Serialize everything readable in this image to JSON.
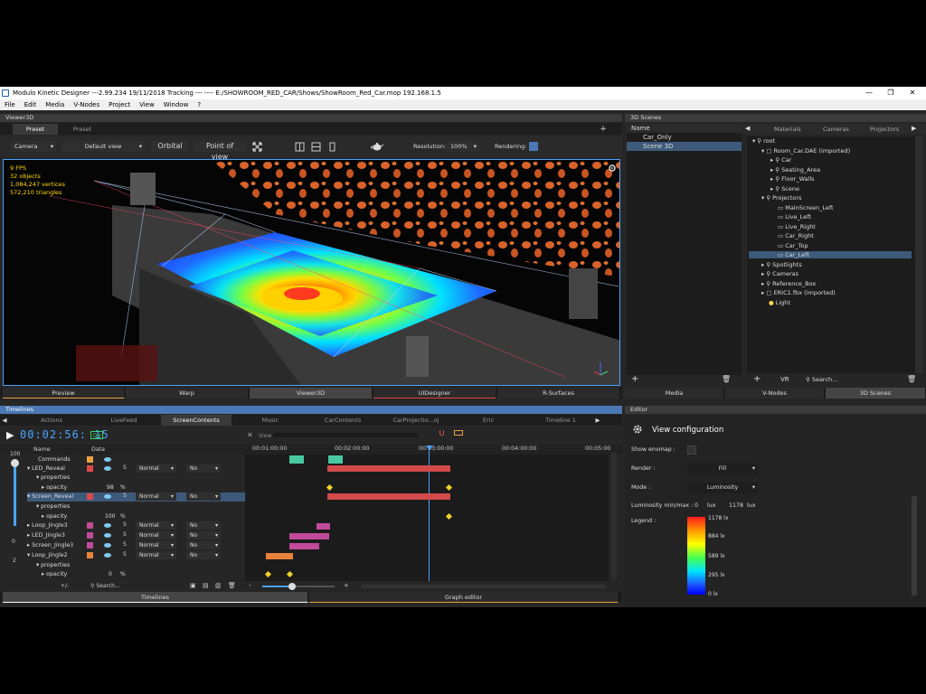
{
  "titlebar": {
    "title": "Modulo Kinetic Designer ---2.99.234 19/11/2018 Tracking ---  ----  E:/SHOWROOM_RED_CAR/Shows/ShowRoom_Red_Car.mop   192.168.1.5",
    "min": "—",
    "max": "❐",
    "close": "✕"
  },
  "menu": [
    "File",
    "Edit",
    "Media",
    "V-Nodes",
    "Project",
    "View",
    "Window",
    "?"
  ],
  "viewer": {
    "header": "Viewer3D",
    "tabs": [
      "Preset",
      "Preset"
    ],
    "plus": "+",
    "camera": "Camera",
    "view": "Default view",
    "orbital": "Orbital",
    "pov": "Point of view",
    "resolution_label": "Resolution:",
    "resolution": "100%",
    "rendering_label": "Rendering:",
    "stats": {
      "fps": "9 FPS",
      "objects": "32 objects",
      "vertices": "1,084,247 vertices",
      "triangles": "572,210 triangles"
    },
    "bottom_tabs": [
      "Preview",
      "Warp",
      "Viewer3D",
      "UIDesigner",
      "R-Surfaces"
    ],
    "colors": {
      "accent": "#4aa3ff",
      "highlight": "#4a78b4"
    }
  },
  "scenes": {
    "header": "3D Scenes",
    "list_header": "Name",
    "list": [
      "Car_Only",
      "Scene 3D"
    ],
    "tabs": [
      "Materials",
      "Cameras",
      "Projectors"
    ],
    "tree": [
      "root",
      "Room_Car.DAE (imported)",
      "Car",
      "Seating_Area",
      "Floor_Walls",
      "Scene",
      "Projectors",
      "MainScreen_Left",
      "Live_Left",
      "Live_Right",
      "Car_Right",
      "Car_Top",
      "Car_Left",
      "Spotlights",
      "Cameras",
      "Reference_Box",
      "ERIC1.fbx (imported)",
      "Light"
    ],
    "footer": {
      "vr": "VR",
      "search": "Search..."
    },
    "bottom_tabs": [
      "Media",
      "V-Nodes",
      "3D Scenes"
    ]
  },
  "timelines": {
    "header": "Timelines",
    "tabs": [
      "Actions",
      "LiveFeed",
      "ScreenContents",
      "Music",
      "CarContents",
      "CarProjectio...oj (imported)",
      "Eric",
      "Timeline 1"
    ],
    "timecode": "00:02:56: 15",
    "on": "ON",
    "view_label": "View",
    "col_name": "Name",
    "col_data": "Data",
    "ruler": [
      "00:01:00:00",
      "00:02:00:00",
      "00:03:00:00",
      "00:04:00:00",
      "00:05:00"
    ],
    "zoom_ticks": [
      "100",
      "0",
      "2"
    ],
    "rows": [
      {
        "name": "Commands"
      },
      {
        "name": "LED_Reveal",
        "s": "S",
        "blend": "Normal",
        "loop": "No"
      },
      {
        "name": "properties"
      },
      {
        "name": "opacity",
        "val": "98",
        "unit": "%"
      },
      {
        "name": "Screen_Reveal",
        "s": "S",
        "blend": "Normal",
        "loop": "No"
      },
      {
        "name": "properties"
      },
      {
        "name": "opacity",
        "val": "100",
        "unit": "%"
      },
      {
        "name": "Loop_Jingle3",
        "s": "S",
        "blend": "Normal",
        "loop": "No"
      },
      {
        "name": "LED_Jingle3",
        "s": "S",
        "blend": "Normal",
        "loop": "No"
      },
      {
        "name": "Screen_Jingle3",
        "s": "S",
        "blend": "Normal",
        "loop": "No"
      },
      {
        "name": "Loop_Jingle2",
        "s": "S",
        "blend": "Normal",
        "loop": "No"
      },
      {
        "name": "properties"
      },
      {
        "name": "opacity",
        "val": "0",
        "unit": "%"
      }
    ],
    "footer": {
      "plusminus": "+/-",
      "search": "Search...",
      "minus": "-",
      "plus": "+"
    },
    "bottom_tabs": [
      "Timelines",
      "Graph editor"
    ]
  },
  "editor": {
    "header": "Editor",
    "title": "View configuration",
    "envmap_label": "Show envmap :",
    "render_label": "Render :",
    "render": "Fill",
    "mode_label": "Mode :",
    "mode": "Luminosity",
    "lum_label": "Luminosity min/max :",
    "lum_min": "0",
    "lum_unit1": "lux",
    "lum_max": "1178",
    "lum_unit2": "lux",
    "legend_label": "Legend :",
    "legend": [
      "1178 lx",
      "884 lx",
      "589 lx",
      "295 lx",
      "0 lx"
    ]
  }
}
